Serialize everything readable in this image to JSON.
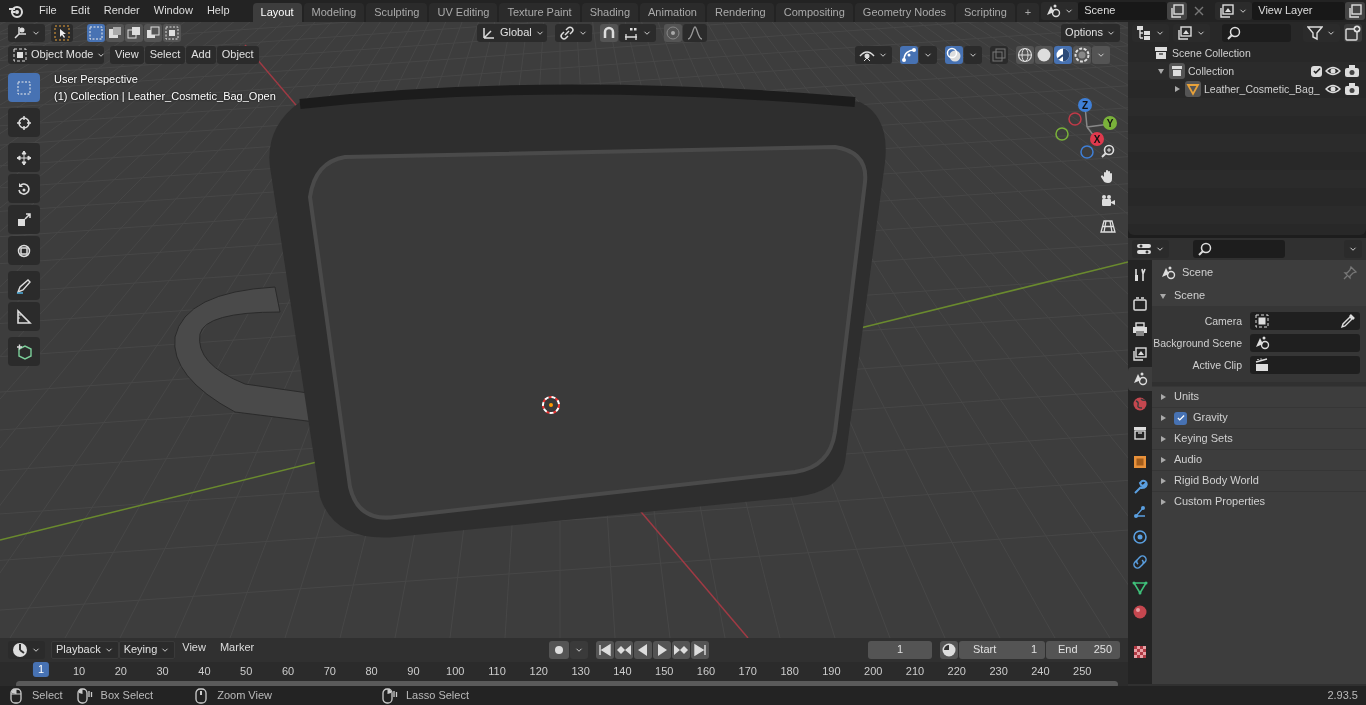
{
  "top_menu": [
    "File",
    "Edit",
    "Render",
    "Window",
    "Help"
  ],
  "workspaces": [
    {
      "label": "Layout",
      "selected": true
    },
    {
      "label": "Modeling",
      "selected": false
    },
    {
      "label": "Sculpting",
      "selected": false
    },
    {
      "label": "UV Editing",
      "selected": false
    },
    {
      "label": "Texture Paint",
      "selected": false
    },
    {
      "label": "Shading",
      "selected": false
    },
    {
      "label": "Animation",
      "selected": false
    },
    {
      "label": "Rendering",
      "selected": false
    },
    {
      "label": "Compositing",
      "selected": false
    },
    {
      "label": "Geometry Nodes",
      "selected": false
    },
    {
      "label": "Scripting",
      "selected": false
    }
  ],
  "add_workspace": "+",
  "scene": {
    "value": "Scene"
  },
  "view_layer": {
    "value": "View Layer"
  },
  "viewport": {
    "select_modes": [
      {
        "selected": true
      },
      {
        "selected": false
      },
      {
        "selected": false
      },
      {
        "selected": false
      },
      {
        "selected": false
      }
    ],
    "orientation": "Global",
    "options": "Options",
    "mode": "Object Mode",
    "menus": [
      "View",
      "Select",
      "Add",
      "Object"
    ],
    "shading": [
      {
        "kind": "wireframe",
        "selected": false
      },
      {
        "kind": "solid",
        "selected": false
      },
      {
        "kind": "material",
        "selected": true
      },
      {
        "kind": "rendered",
        "selected": false
      }
    ],
    "overlay_info": [
      "User Perspective",
      "(1) Collection | Leather_Cosmetic_Bag_Open"
    ],
    "tools": [
      {
        "kind": "select",
        "selected": true
      },
      {
        "kind": "cursor",
        "selected": false
      },
      {
        "kind": "move",
        "selected": false
      },
      {
        "kind": "rotate",
        "selected": false
      },
      {
        "kind": "scale",
        "selected": false
      },
      {
        "kind": "transform",
        "selected": false
      },
      {
        "kind": "annotate",
        "selected": false
      },
      {
        "kind": "measure",
        "selected": false
      },
      {
        "kind": "add_cube",
        "selected": false
      }
    ],
    "gizmo_axes": {
      "z": "Z",
      "y": "Y",
      "x": "X"
    }
  },
  "outliner": {
    "items": [
      {
        "label": "Scene Collection",
        "kind": "scene_collection",
        "children": [
          {
            "label": "Collection",
            "kind": "collection",
            "expanded": true,
            "checked": true,
            "children": [
              {
                "label": "Leather_Cosmetic_Bag_",
                "kind": "object",
                "expanded": false
              }
            ]
          }
        ]
      }
    ]
  },
  "properties": {
    "tabs": [
      {
        "kind": "tool",
        "selected": false
      },
      {
        "kind": "render",
        "selected": false
      },
      {
        "kind": "output",
        "selected": false
      },
      {
        "kind": "view_layer",
        "selected": false
      },
      {
        "kind": "scene",
        "selected": true
      },
      {
        "kind": "world",
        "selected": false
      },
      {
        "kind": "collection",
        "selected": false
      },
      {
        "kind": "object",
        "selected": false
      },
      {
        "kind": "modifier",
        "selected": false
      },
      {
        "kind": "particles",
        "selected": false
      },
      {
        "kind": "physics",
        "selected": false
      },
      {
        "kind": "constraints",
        "selected": false
      },
      {
        "kind": "data",
        "selected": false
      },
      {
        "kind": "material",
        "selected": false
      },
      {
        "kind": "texture",
        "selected": false
      }
    ],
    "context": "Scene",
    "panel": {
      "title": "Scene",
      "expanded": true,
      "fields": [
        {
          "label": "Camera",
          "kind": "camera"
        },
        {
          "label": "Background Scene",
          "kind": "scene"
        },
        {
          "label": "Active Clip",
          "kind": "clip"
        }
      ]
    },
    "subpanels": [
      {
        "label": "Units",
        "expanded": false
      },
      {
        "label": "Gravity",
        "expanded": false,
        "checked": true
      },
      {
        "label": "Keying Sets",
        "expanded": false
      },
      {
        "label": "Audio",
        "expanded": false
      },
      {
        "label": "Rigid Body World",
        "expanded": false
      },
      {
        "label": "Custom Properties",
        "expanded": false
      }
    ]
  },
  "timeline": {
    "menus": [
      {
        "label": "Playback",
        "dropdown": true
      },
      {
        "label": "Keying",
        "dropdown": true
      },
      {
        "label": "View",
        "dropdown": false
      },
      {
        "label": "Marker",
        "dropdown": false
      }
    ],
    "current_frame": "1",
    "start": {
      "label": "Start",
      "value": "1"
    },
    "end": {
      "label": "End",
      "value": "250"
    },
    "playhead": "1",
    "ticks": [
      "10",
      "20",
      "30",
      "40",
      "50",
      "60",
      "70",
      "80",
      "90",
      "100",
      "110",
      "120",
      "130",
      "140",
      "150",
      "160",
      "170",
      "180",
      "190",
      "200",
      "210",
      "220",
      "230",
      "240",
      "250"
    ]
  },
  "status_bar": {
    "hints": [
      {
        "kind": "left_click",
        "label": "Select"
      },
      {
        "kind": "left_drag",
        "label": "Box Select"
      },
      {
        "kind": "middle_click",
        "label": "Zoom View"
      },
      {
        "kind": "right_drag",
        "label": "Lasso Select"
      }
    ],
    "version": "2.93.5"
  }
}
